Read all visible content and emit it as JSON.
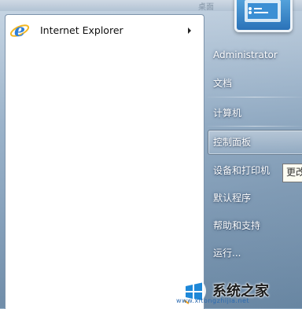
{
  "programs": [
    {
      "label": "Internet Explorer",
      "icon": "internet-explorer-icon",
      "has_submenu": true
    }
  ],
  "right_pane": {
    "user": "Administrator",
    "documents": "文档",
    "computer": "计算机",
    "control_panel": "控制面板",
    "devices_printers": "设备和打印机",
    "default_programs": "默认程序",
    "help_support": "帮助和支持",
    "run": "运行..."
  },
  "tooltip": "更改",
  "top_strip_text": "桌面",
  "watermark": {
    "text": "系统之家",
    "url": "www.xitongzhijia.net"
  },
  "colors": {
    "accent": "#2a72b8",
    "menu_bg": "#ffffff",
    "right_text": "#ffffff"
  }
}
